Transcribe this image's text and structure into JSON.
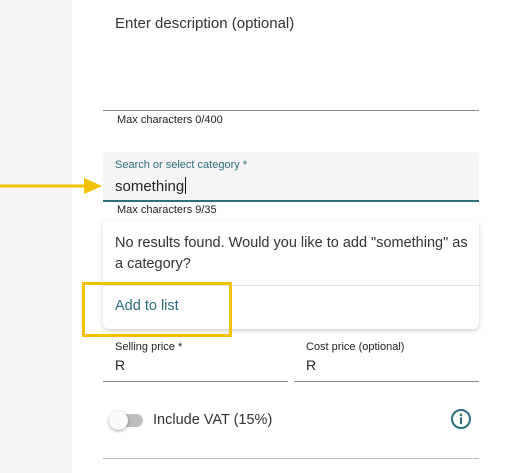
{
  "description": {
    "placeholder": "Enter description (optional)",
    "helper": "Max characters 0/400"
  },
  "category": {
    "label": "Search or select category *",
    "value": "something",
    "helper": "Max characters 9/35"
  },
  "dropdown": {
    "message": "No results found. Would you like to add \"something\" as a category?",
    "action_label": "Add to list"
  },
  "pricing": {
    "selling_label": "Selling price *",
    "selling_value": "R",
    "cost_label": "Cost price (optional)",
    "cost_value": "R"
  },
  "vat": {
    "label": "Include VAT (15%)",
    "enabled": false
  },
  "icons": {
    "info": "info-circle-icon",
    "arrow": "arrow-right-icon"
  },
  "colors": {
    "accent": "#2b6f7a",
    "annotation": "#f2c200"
  }
}
